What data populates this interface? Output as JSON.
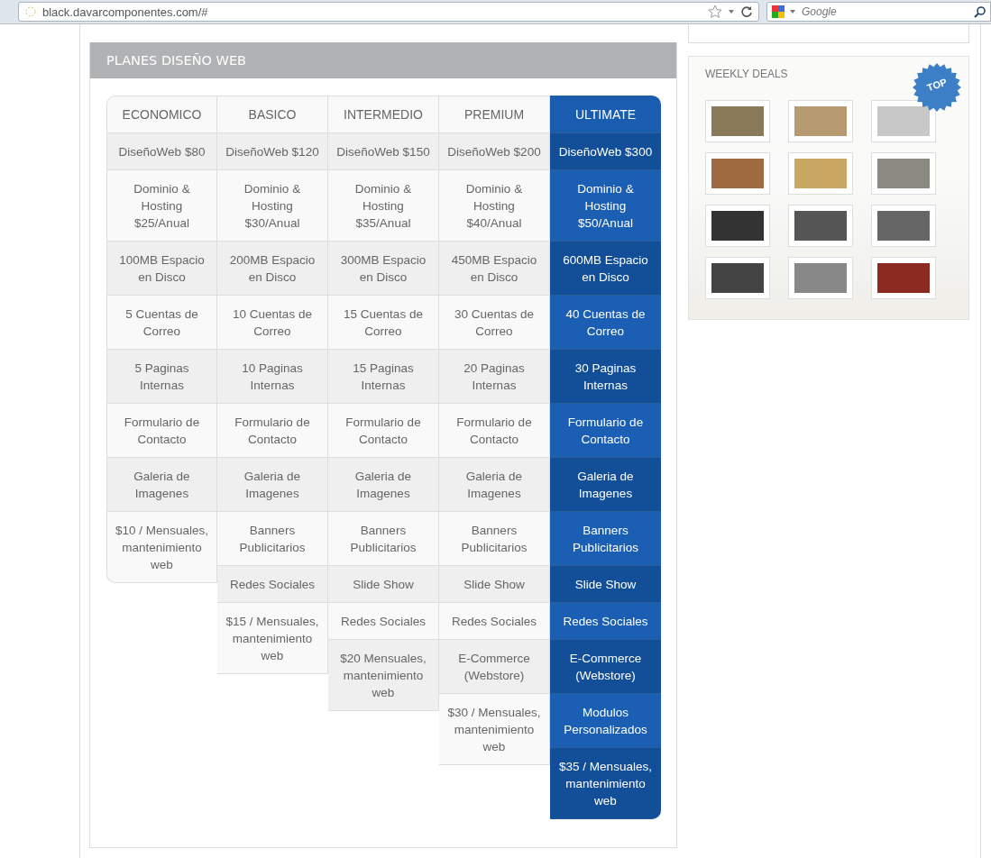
{
  "browser": {
    "url": "black.davarcomponentes.com/#",
    "search": {
      "placeholder": "Google"
    }
  },
  "panel": {
    "title": "PLANES DISEÑO WEB"
  },
  "plans": [
    {
      "name": "ECONOMICO",
      "featured": false,
      "features": [
        "DiseñoWeb $80",
        "Dominio &\nHosting\n$25/Anual",
        "100MB Espacio\nen Disco",
        "5 Cuentas de\nCorreo",
        "5 Paginas\nInternas",
        "Formulario de\nContacto",
        "Galeria de\nImagenes",
        "$10 / Mensuales,\nmantenimiento\nweb"
      ]
    },
    {
      "name": "BASICO",
      "featured": false,
      "features": [
        "DiseñoWeb $120",
        "Dominio &\nHosting\n$30/Anual",
        "200MB Espacio\nen Disco",
        "10 Cuentas de\nCorreo",
        "10 Paginas\nInternas",
        "Formulario de\nContacto",
        "Galeria de\nImagenes",
        "Banners\nPublicitarios",
        "Redes Sociales",
        "$15 / Mensuales,\nmantenimiento\nweb"
      ]
    },
    {
      "name": "INTERMEDIO",
      "featured": false,
      "features": [
        "DiseñoWeb $150",
        "Dominio &\nHosting\n$35/Anual",
        "300MB Espacio\nen Disco",
        "15 Cuentas de\nCorreo",
        "15 Paginas\nInternas",
        "Formulario de\nContacto",
        "Galeria de\nImagenes",
        "Banners\nPublicitarios",
        "Slide Show",
        "Redes Sociales",
        "$20 Mensuales,\nmantenimiento\nweb"
      ]
    },
    {
      "name": "PREMIUM",
      "featured": false,
      "features": [
        "DiseñoWeb $200",
        "Dominio &\nHosting\n$40/Anual",
        "450MB Espacio\nen Disco",
        "30 Cuentas de\nCorreo",
        "20 Paginas\nInternas",
        "Formulario de\nContacto",
        "Galeria de\nImagenes",
        "Banners\nPublicitarios",
        "Slide Show",
        "Redes Sociales",
        "E-Commerce\n(Webstore)",
        "$30 / Mensuales,\nmantenimiento\nweb"
      ]
    },
    {
      "name": "ULTIMATE",
      "featured": true,
      "features": [
        "DiseñoWeb $300",
        "Dominio &\nHosting\n$50/Anual",
        "600MB Espacio\nen Disco",
        "40 Cuentas de\nCorreo",
        "30 Paginas\nInternas",
        "Formulario de\nContacto",
        "Galeria de\nImagenes",
        "Banners\nPublicitarios",
        "Slide Show",
        "Redes Sociales",
        "E-Commerce\n(Webstore)",
        "Modulos\nPersonalizados",
        "$35 / Mensuales,\nmantenimiento\nweb"
      ]
    }
  ],
  "weekly_deals": {
    "title": "WEEKLY DEALS",
    "badge": "TOP"
  }
}
